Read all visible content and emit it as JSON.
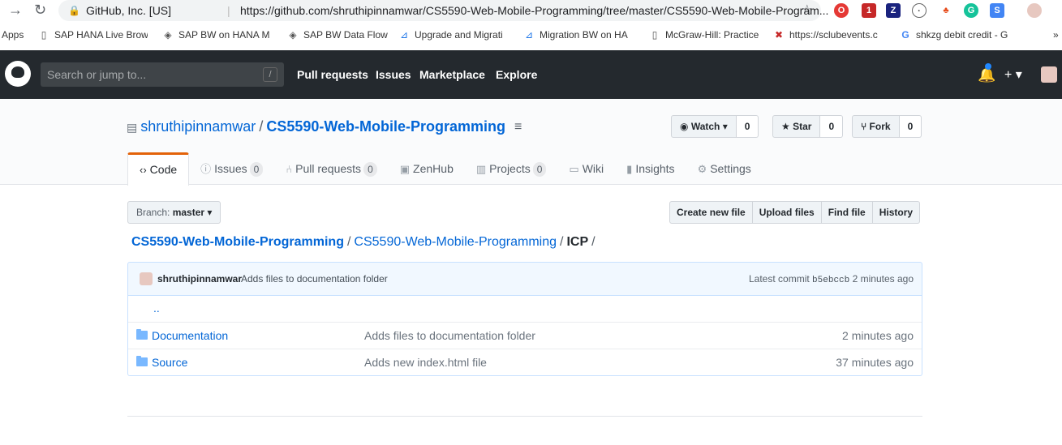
{
  "browser": {
    "org_label": "GitHub, Inc. [US]",
    "url": "https://github.com/shruthipinnamwar/CS5590-Web-Mobile-Programming/tree/master/CS5590-Web-Mobile-Program...",
    "ext_badge": "1"
  },
  "bookmarks": [
    {
      "label": "Apps",
      "icon": "apps-grid-icon"
    },
    {
      "label": "SAP HANA Live Brow",
      "icon": "page-icon"
    },
    {
      "label": "SAP BW on HANA M",
      "icon": "diamond-icon"
    },
    {
      "label": "SAP BW Data Flow",
      "icon": "diamond-icon"
    },
    {
      "label": "Upgrade and Migrati",
      "icon": "sap-icon"
    },
    {
      "label": "Migration BW on HA",
      "icon": "sap-icon"
    },
    {
      "label": "McGraw-Hill: Practice",
      "icon": "page-icon"
    },
    {
      "label": "https://sclubevents.c",
      "icon": "club-icon"
    },
    {
      "label": "shkzg debit credit - G",
      "icon": "google-icon"
    },
    {
      "label": "»",
      "icon": "more-icon"
    }
  ],
  "header": {
    "search_placeholder": "Search or jump to...",
    "search_key": "/",
    "nav": [
      "Pull requests",
      "Issues",
      "Marketplace",
      "Explore"
    ],
    "plus": "+ ▾"
  },
  "repo": {
    "owner": "shruthipinnamwar",
    "sep": "/",
    "name": "CS5590-Web-Mobile-Programming",
    "watch": {
      "label": "Watch ▾",
      "count": "0"
    },
    "star": {
      "label": "Star",
      "count": "0"
    },
    "fork": {
      "label": "Fork",
      "count": "0"
    }
  },
  "tabs": [
    {
      "label": "Code",
      "icon": "code-icon",
      "counter": ""
    },
    {
      "label": "Issues",
      "icon": "issue-icon",
      "counter": "0"
    },
    {
      "label": "Pull requests",
      "icon": "pull-request-icon",
      "counter": "0"
    },
    {
      "label": "ZenHub",
      "icon": "zenhub-icon",
      "counter": ""
    },
    {
      "label": "Projects",
      "icon": "project-icon",
      "counter": "0"
    },
    {
      "label": "Wiki",
      "icon": "book-icon",
      "counter": ""
    },
    {
      "label": "Insights",
      "icon": "graph-icon",
      "counter": ""
    },
    {
      "label": "Settings",
      "icon": "gear-icon",
      "counter": ""
    }
  ],
  "branch": {
    "prefix": "Branch:",
    "name": "master ▾"
  },
  "file_nav": [
    "Create new file",
    "Upload files",
    "Find file",
    "History"
  ],
  "breadcrumb": {
    "root": "CS5590-Web-Mobile-Programming",
    "sub": "CS5590-Web-Mobile-Programming",
    "current": "ICP",
    "sep": "/"
  },
  "commit": {
    "author": "shruthipinnamwar",
    "message": "Adds files to documentation folder",
    "latest_label": "Latest commit",
    "sha": "b5ebccb",
    "age": "2 minutes ago"
  },
  "files": {
    "up": "..",
    "rows": [
      {
        "name": "Documentation",
        "message": "Adds files to documentation folder",
        "age": "2 minutes ago"
      },
      {
        "name": "Source",
        "message": "Adds new index.html file",
        "age": "37 minutes ago"
      }
    ]
  },
  "colors": {
    "header_bg": "#24292e",
    "link": "#0366d6",
    "tab_accent": "#e36209",
    "commit_bg": "#f1f8ff"
  }
}
